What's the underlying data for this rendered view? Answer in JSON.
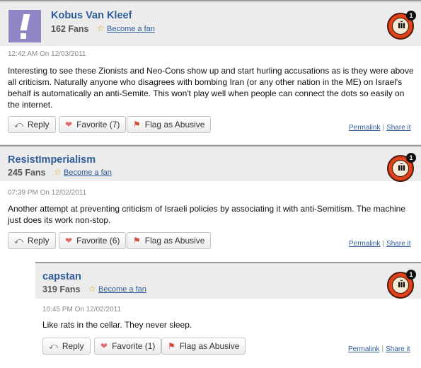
{
  "comments": [
    {
      "username": "Kobus Van Kleef",
      "fans": "162 Fans",
      "become_fan": "Become a fan",
      "badge_glyph": "ıĭı",
      "badge_count": "1",
      "timestamp": "12:42 AM On 12/03/2011",
      "text": "Interesting to see these Zionists and Neo-Cons show up and start hurling accusations as is they were above all criticism. Naturally anyone who disagrees with bombing Iran (or any other nation in the ME) on Israel's behalf is automatically an anti-Semite. This won't play well when people can connect the dots so easily on the internet.",
      "reply": "Reply",
      "favorite": "Favorite (7)",
      "flag": "Flag as Abusive",
      "permalink": "Permalink",
      "share": "Share it"
    },
    {
      "username": "ResistImperialism",
      "fans": "245 Fans",
      "become_fan": "Become a fan",
      "badge_glyph": "ıĭı",
      "badge_count": "1",
      "timestamp": "07:39 PM On 12/02/2011",
      "text": "Another attempt at preventing criticism of Israeli policies by associating it with anti-Semitism. The machine just does its work non-stop.",
      "reply": "Reply",
      "favorite": "Favorite (6)",
      "flag": "Flag as Abusive",
      "permalink": "Permalink",
      "share": "Share it"
    },
    {
      "username": "capstan",
      "fans": "319 Fans",
      "become_fan": "Become a fan",
      "badge_glyph": "ıĭı",
      "badge_count": "1",
      "timestamp": "10:45 PM On 12/02/2011",
      "text": "Like rats in the cellar. They never sleep.",
      "reply": "Reply",
      "favorite": "Favorite (1)",
      "flag": "Flag as Abusive",
      "permalink": "Permalink",
      "share": "Share it"
    }
  ],
  "icons": {
    "reply": "reply-arrow-icon",
    "favorite": "heart-icon",
    "flag": "flag-icon",
    "star": "star-icon",
    "badge": "pundit-badge-icon"
  },
  "colors": {
    "username": "#2f5c9a",
    "header_bg": "#ececec",
    "badge_red": "#e2421a",
    "avatar_purple": "#8f86c6"
  }
}
